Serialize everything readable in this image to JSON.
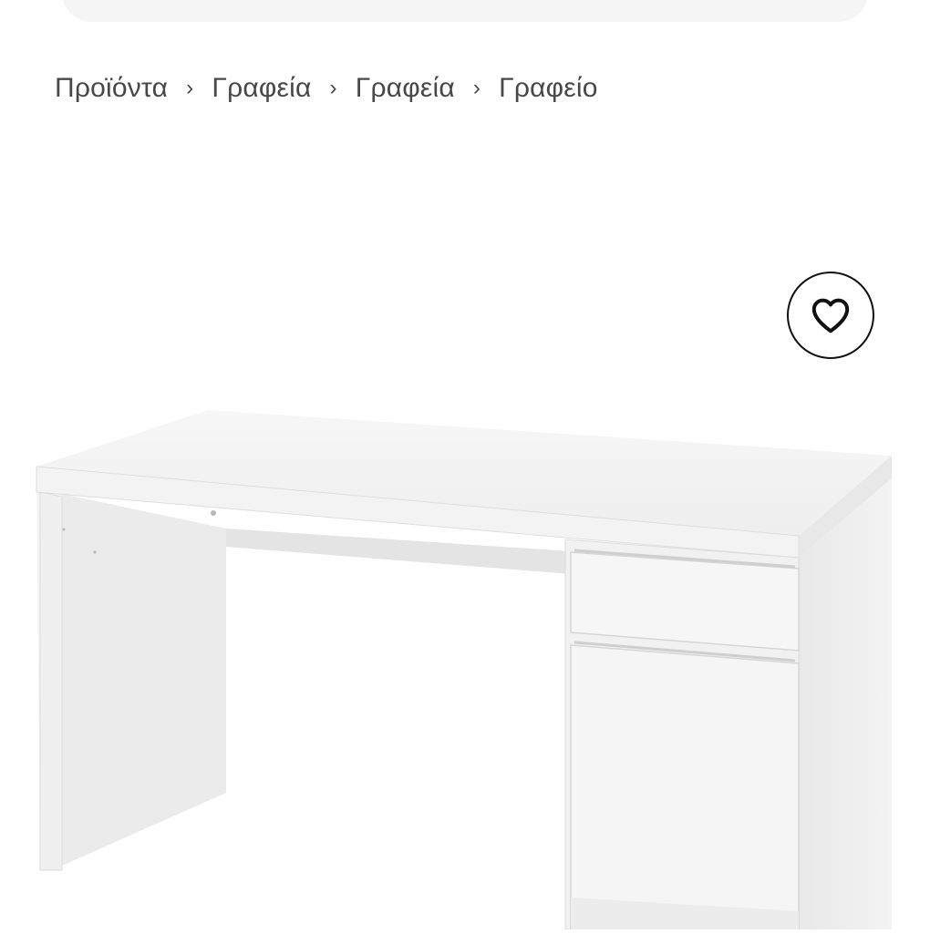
{
  "search": {
    "placeholder": ""
  },
  "breadcrumb": {
    "items": [
      {
        "label": "Προϊόντα"
      },
      {
        "label": "Γραφεία"
      },
      {
        "label": "Γραφεία"
      },
      {
        "label": "Γραφείο"
      }
    ],
    "separator": "›"
  },
  "product": {
    "image_icon": "white-desk-with-drawer-cabinet",
    "favourite_icon": "heart-icon"
  },
  "colors": {
    "search_bg": "#f5f5f5",
    "text": "#484848",
    "icon": "#111111",
    "desk_white": "#f2f2f2"
  }
}
